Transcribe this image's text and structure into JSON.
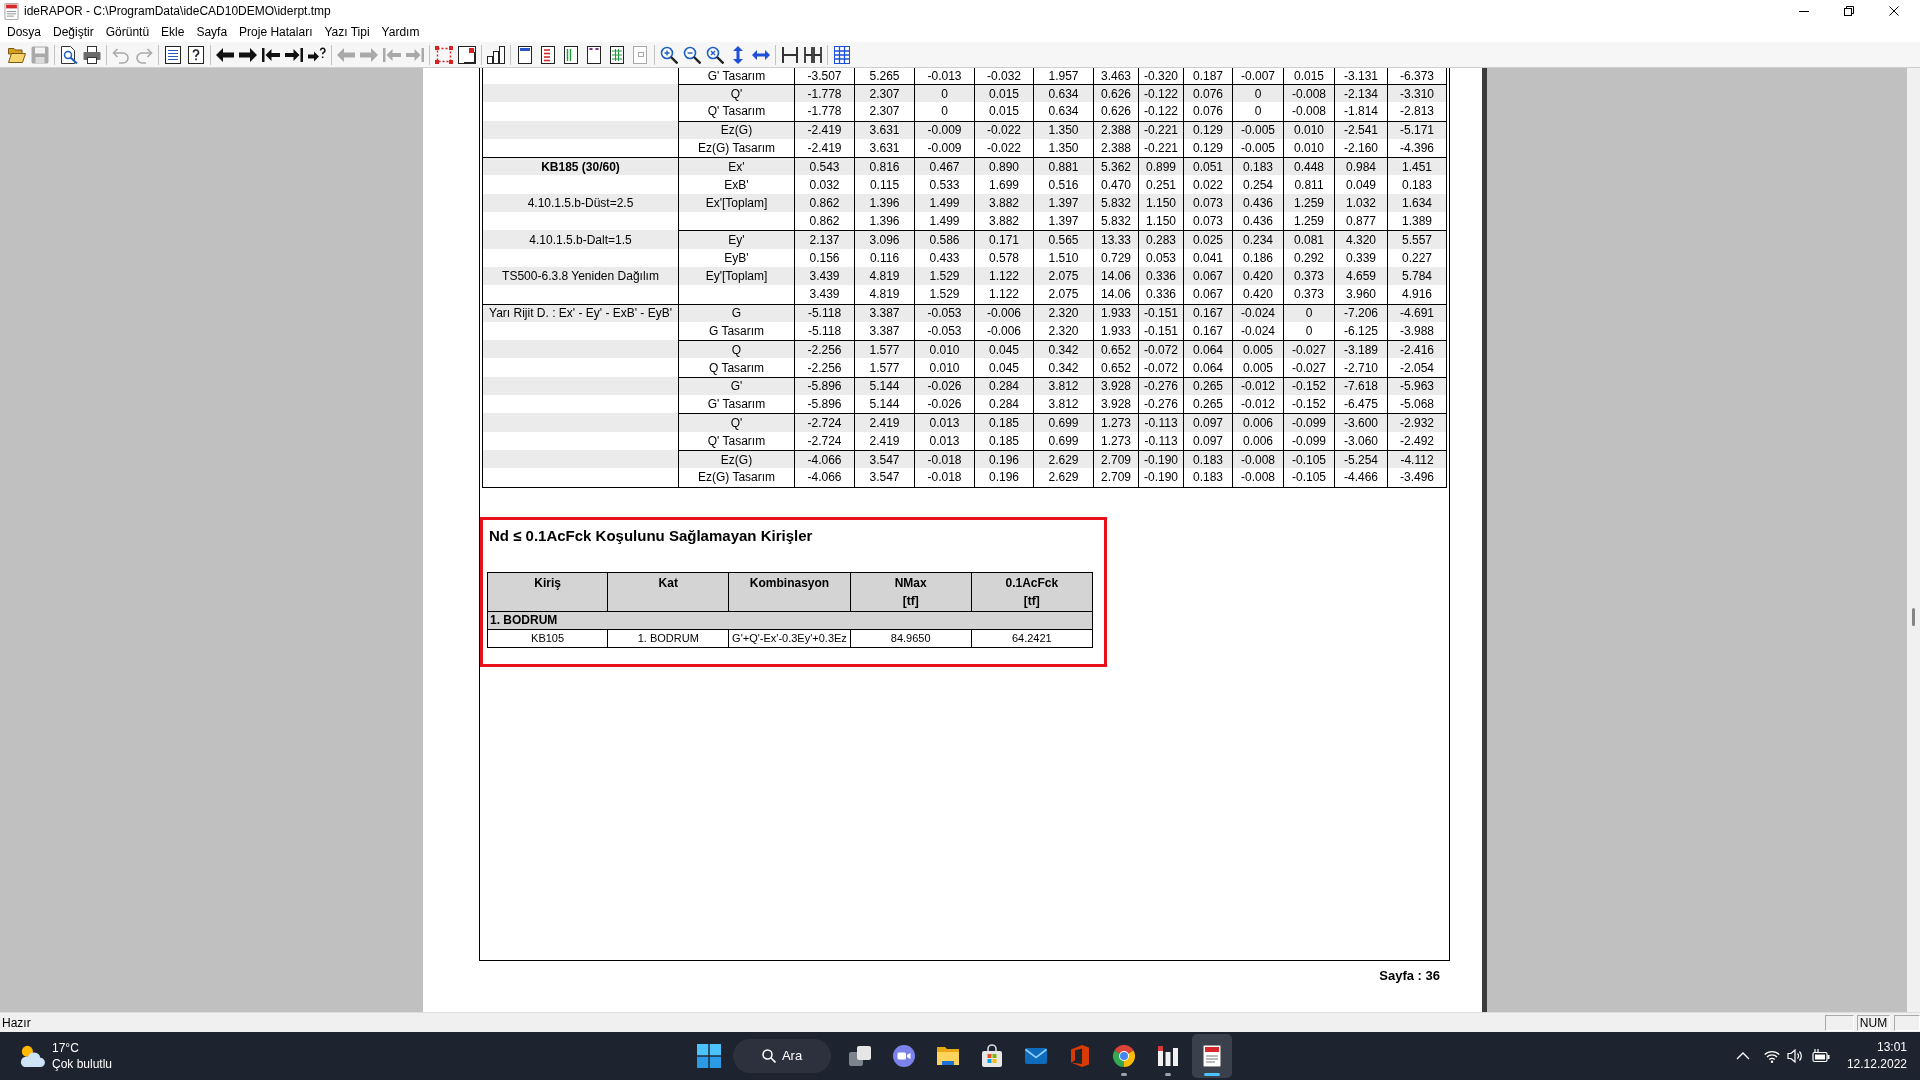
{
  "window": {
    "title": "ideRAPOR - C:\\ProgramData\\ideCAD10DEMO\\iderpt.tmp"
  },
  "menu": [
    "Dosya",
    "Değiştir",
    "Görüntü",
    "Ekle",
    "Sayfa",
    "Proje Hataları",
    "Yazı Tipi",
    "Yardım"
  ],
  "toolbar": [
    [
      {
        "kind": "open",
        "disabled": false
      },
      {
        "kind": "save",
        "disabled": true
      }
    ],
    [
      {
        "kind": "preview",
        "disabled": false
      },
      {
        "kind": "print",
        "disabled": false
      }
    ],
    [
      {
        "kind": "undo",
        "disabled": true
      },
      {
        "kind": "redo",
        "disabled": true
      }
    ],
    [
      {
        "kind": "sheet",
        "disabled": false
      },
      {
        "kind": "help",
        "disabled": false
      }
    ],
    [
      {
        "kind": "prev",
        "disabled": false
      },
      {
        "kind": "next",
        "disabled": false
      },
      {
        "kind": "first",
        "disabled": false
      },
      {
        "kind": "last",
        "disabled": false
      },
      {
        "kind": "goto",
        "disabled": false
      }
    ],
    [
      {
        "kind": "prev",
        "disabled": true
      },
      {
        "kind": "next",
        "disabled": true
      },
      {
        "kind": "first",
        "disabled": true
      },
      {
        "kind": "last",
        "disabled": true
      }
    ],
    [
      {
        "kind": "frame",
        "disabled": false
      },
      {
        "kind": "corner",
        "disabled": false
      }
    ],
    [
      {
        "kind": "blocks",
        "disabled": false
      }
    ],
    [
      {
        "kind": "pagetop",
        "disabled": false
      },
      {
        "kind": "pagelist",
        "disabled": false
      },
      {
        "kind": "pagecols",
        "disabled": false
      },
      {
        "kind": "pagemarks",
        "disabled": false
      },
      {
        "kind": "pagegrid",
        "disabled": false
      },
      {
        "kind": "pagesmall",
        "disabled": true
      }
    ],
    [
      {
        "kind": "zoomin",
        "disabled": false
      },
      {
        "kind": "zoomout",
        "disabled": false
      },
      {
        "kind": "zoomfit",
        "disabled": false
      },
      {
        "kind": "vspace",
        "disabled": false
      },
      {
        "kind": "hspace",
        "disabled": false
      }
    ],
    [
      {
        "kind": "single",
        "disabled": false
      },
      {
        "kind": "double",
        "disabled": false
      }
    ],
    [
      {
        "kind": "grid",
        "disabled": false
      }
    ]
  ],
  "report": {
    "force_table": {
      "blocks": [
        {
          "groups": [
            [
              {
                "combination": "G' Tasarım",
                "values": [
                  "-3.507",
                  "5.265",
                  "-0.013",
                  "-0.032",
                  "1.957",
                  "3.463",
                  "-0.320",
                  "0.187",
                  "-0.007",
                  "0.015",
                  "-3.131",
                  "-6.373"
                ]
              }
            ],
            [
              {
                "combination": "Q'",
                "values": [
                  "-1.778",
                  "2.307",
                  "0",
                  "0.015",
                  "0.634",
                  "0.626",
                  "-0.122",
                  "0.076",
                  "0",
                  "-0.008",
                  "-2.134",
                  "-3.310"
                ]
              },
              {
                "combination": "Q' Tasarım",
                "values": [
                  "-1.778",
                  "2.307",
                  "0",
                  "0.015",
                  "0.634",
                  "0.626",
                  "-0.122",
                  "0.076",
                  "0",
                  "-0.008",
                  "-1.814",
                  "-2.813"
                ]
              }
            ],
            [
              {
                "combination": "Ez(G)",
                "values": [
                  "-2.419",
                  "3.631",
                  "-0.009",
                  "-0.022",
                  "1.350",
                  "2.388",
                  "-0.221",
                  "0.129",
                  "-0.005",
                  "0.010",
                  "-2.541",
                  "-5.171"
                ]
              },
              {
                "combination": "Ez(G) Tasarım",
                "values": [
                  "-2.419",
                  "3.631",
                  "-0.009",
                  "-0.022",
                  "1.350",
                  "2.388",
                  "-0.221",
                  "0.129",
                  "-0.005",
                  "0.010",
                  "-2.160",
                  "-4.396"
                ]
              }
            ]
          ]
        },
        {
          "groups": [
            [
              {
                "note": {
                  "kind": "beam",
                  "text": "KB185 (30/60)"
                },
                "combination": "Ex'",
                "values": [
                  "0.543",
                  "0.816",
                  "0.467",
                  "0.890",
                  "0.881",
                  "5.362",
                  "0.899",
                  "0.051",
                  "0.183",
                  "0.448",
                  "0.984",
                  "1.451"
                ]
              },
              {
                "combination": "ExB'",
                "values": [
                  "0.032",
                  "0.115",
                  "0.533",
                  "1.699",
                  "0.516",
                  "0.470",
                  "0.251",
                  "0.022",
                  "0.254",
                  "0.811",
                  "0.049",
                  "0.183"
                ]
              },
              {
                "note": {
                  "kind": "rule",
                  "text": "4.10.1.5.b-Düst=2.5"
                },
                "combination": "Ex'[Toplam]",
                "values": [
                  "0.862",
                  "1.396",
                  "1.499",
                  "3.882",
                  "1.397",
                  "5.832",
                  "1.150",
                  "0.073",
                  "0.436",
                  "1.259",
                  "1.032",
                  "1.634"
                ]
              },
              {
                "values": [
                  "0.862",
                  "1.396",
                  "1.499",
                  "3.882",
                  "1.397",
                  "5.832",
                  "1.150",
                  "0.073",
                  "0.436",
                  "1.259",
                  "0.877",
                  "1.389"
                ]
              }
            ],
            [
              {
                "note": {
                  "kind": "rule",
                  "text": "4.10.1.5.b-Dalt=1.5"
                },
                "combination": "Ey'",
                "values": [
                  "2.137",
                  "3.096",
                  "0.586",
                  "0.171",
                  "0.565",
                  "13.33",
                  "0.283",
                  "0.025",
                  "0.234",
                  "0.081",
                  "4.320",
                  "5.557"
                ]
              },
              {
                "combination": "EyB'",
                "values": [
                  "0.156",
                  "0.116",
                  "0.433",
                  "0.578",
                  "1.510",
                  "0.729",
                  "0.053",
                  "0.041",
                  "0.186",
                  "0.292",
                  "0.339",
                  "0.227"
                ]
              },
              {
                "note": {
                  "kind": "rule",
                  "text": "TS500-6.3.8 Yeniden Dağılım"
                },
                "combination": "Ey'[Toplam]",
                "values": [
                  "3.439",
                  "4.819",
                  "1.529",
                  "1.122",
                  "2.075",
                  "14.06",
                  "0.336",
                  "0.067",
                  "0.420",
                  "0.373",
                  "4.659",
                  "5.784"
                ]
              },
              {
                "values": [
                  "3.439",
                  "4.819",
                  "1.529",
                  "1.122",
                  "2.075",
                  "14.06",
                  "0.336",
                  "0.067",
                  "0.420",
                  "0.373",
                  "3.960",
                  "4.916"
                ]
              }
            ]
          ]
        },
        {
          "groups": [
            [
              {
                "note": {
                  "kind": "rule",
                  "text": "Yarı Rijit D. : Ex' - Ey' - ExB' - EyB'"
                },
                "combination": "G",
                "values": [
                  "-5.118",
                  "3.387",
                  "-0.053",
                  "-0.006",
                  "2.320",
                  "1.933",
                  "-0.151",
                  "0.167",
                  "-0.024",
                  "0",
                  "-7.206",
                  "-4.691"
                ]
              },
              {
                "combination": "G Tasarım",
                "values": [
                  "-5.118",
                  "3.387",
                  "-0.053",
                  "-0.006",
                  "2.320",
                  "1.933",
                  "-0.151",
                  "0.167",
                  "-0.024",
                  "0",
                  "-6.125",
                  "-3.988"
                ]
              }
            ],
            [
              {
                "combination": "Q",
                "values": [
                  "-2.256",
                  "1.577",
                  "0.010",
                  "0.045",
                  "0.342",
                  "0.652",
                  "-0.072",
                  "0.064",
                  "0.005",
                  "-0.027",
                  "-3.189",
                  "-2.416"
                ]
              },
              {
                "combination": "Q Tasarım",
                "values": [
                  "-2.256",
                  "1.577",
                  "0.010",
                  "0.045",
                  "0.342",
                  "0.652",
                  "-0.072",
                  "0.064",
                  "0.005",
                  "-0.027",
                  "-2.710",
                  "-2.054"
                ]
              }
            ],
            [
              {
                "combination": "G'",
                "values": [
                  "-5.896",
                  "5.144",
                  "-0.026",
                  "0.284",
                  "3.812",
                  "3.928",
                  "-0.276",
                  "0.265",
                  "-0.012",
                  "-0.152",
                  "-7.618",
                  "-5.963"
                ]
              },
              {
                "combination": "G' Tasarım",
                "values": [
                  "-5.896",
                  "5.144",
                  "-0.026",
                  "0.284",
                  "3.812",
                  "3.928",
                  "-0.276",
                  "0.265",
                  "-0.012",
                  "-0.152",
                  "-6.475",
                  "-5.068"
                ]
              }
            ],
            [
              {
                "combination": "Q'",
                "values": [
                  "-2.724",
                  "2.419",
                  "0.013",
                  "0.185",
                  "0.699",
                  "1.273",
                  "-0.113",
                  "0.097",
                  "0.006",
                  "-0.099",
                  "-3.600",
                  "-2.932"
                ]
              },
              {
                "combination": "Q' Tasarım",
                "values": [
                  "-2.724",
                  "2.419",
                  "0.013",
                  "0.185",
                  "0.699",
                  "1.273",
                  "-0.113",
                  "0.097",
                  "0.006",
                  "-0.099",
                  "-3.060",
                  "-2.492"
                ]
              }
            ],
            [
              {
                "combination": "Ez(G)",
                "values": [
                  "-4.066",
                  "3.547",
                  "-0.018",
                  "0.196",
                  "2.629",
                  "2.709",
                  "-0.190",
                  "0.183",
                  "-0.008",
                  "-0.105",
                  "-5.254",
                  "-4.112"
                ]
              },
              {
                "combination": "Ez(G) Tasarım",
                "values": [
                  "-4.066",
                  "3.547",
                  "-0.018",
                  "0.196",
                  "2.629",
                  "2.709",
                  "-0.190",
                  "0.183",
                  "-0.008",
                  "-0.105",
                  "-4.466",
                  "-3.496"
                ]
              }
            ]
          ]
        }
      ]
    },
    "failing_beams": {
      "title": "Nd ≤ 0.1AcFck Koşulunu Sağlamayan Kirişler",
      "columns": [
        "Kiriş",
        "Kat",
        "Kombinasyon",
        "NMax\n[tf]",
        "0.1AcFck\n[tf]"
      ],
      "groups": [
        {
          "name": "1. BODRUM",
          "rows": [
            [
              "KB105",
              "1. BODRUM",
              "G'+Q'-Ex'-0.3Ey'+0.3Ez",
              "84.9650",
              "64.2421"
            ]
          ]
        }
      ]
    },
    "page_number": "Sayfa : 36"
  },
  "status_bar": {
    "message": "Hazır",
    "indicator": "NUM"
  },
  "taskbar": {
    "weather": {
      "temperature": "17°C",
      "condition": "Çok bulutlu"
    },
    "search": "Ara",
    "apps": [
      {
        "kind": "taskview",
        "running": false,
        "active": false
      },
      {
        "kind": "chat",
        "running": false,
        "active": false
      },
      {
        "kind": "explorer",
        "running": false,
        "active": false
      },
      {
        "kind": "store",
        "running": false,
        "active": false
      },
      {
        "kind": "mail",
        "running": false,
        "active": false
      },
      {
        "kind": "office",
        "running": false,
        "active": false
      },
      {
        "kind": "chrome",
        "running": true,
        "active": false
      },
      {
        "kind": "charts",
        "running": true,
        "active": false
      },
      {
        "kind": "iderapor",
        "running": true,
        "active": true
      }
    ],
    "clock": {
      "time": "13:01",
      "date": "12.12.2022"
    }
  }
}
